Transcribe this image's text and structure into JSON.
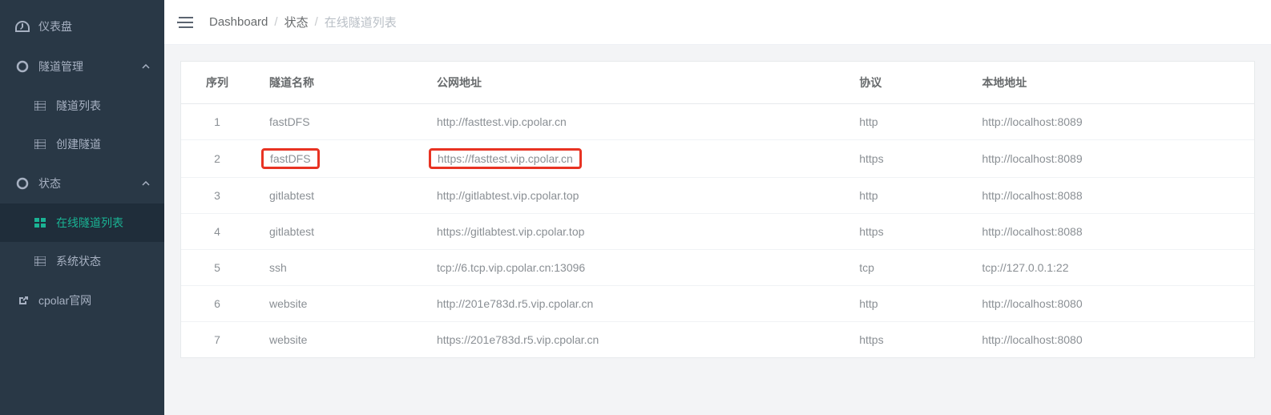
{
  "sidebar": {
    "items": [
      {
        "label": "仪表盘",
        "icon": "dashboard"
      },
      {
        "label": "隧道管理",
        "icon": "ring",
        "expand": true,
        "children": [
          {
            "label": "隧道列表",
            "icon": "table"
          },
          {
            "label": "创建隧道",
            "icon": "table"
          }
        ]
      },
      {
        "label": "状态",
        "icon": "ring",
        "expand": true,
        "children": [
          {
            "label": "在线隧道列表",
            "icon": "grid",
            "active": true
          },
          {
            "label": "系统状态",
            "icon": "table"
          }
        ]
      },
      {
        "label": "cpolar官网",
        "icon": "external"
      }
    ]
  },
  "breadcrumb": {
    "root": "Dashboard",
    "mid": "状态",
    "current": "在线隧道列表"
  },
  "table": {
    "headers": {
      "index": "序列",
      "name": "隧道名称",
      "addr": "公网地址",
      "proto": "协议",
      "local": "本地地址"
    },
    "rows": [
      {
        "index": "1",
        "name": "fastDFS",
        "addr": "http://fasttest.vip.cpolar.cn",
        "proto": "http",
        "local": "http://localhost:8089"
      },
      {
        "index": "2",
        "name": "fastDFS",
        "addr": "https://fasttest.vip.cpolar.cn",
        "proto": "https",
        "local": "http://localhost:8089",
        "hl": true
      },
      {
        "index": "3",
        "name": "gitlabtest",
        "addr": "http://gitlabtest.vip.cpolar.top",
        "proto": "http",
        "local": "http://localhost:8088"
      },
      {
        "index": "4",
        "name": "gitlabtest",
        "addr": "https://gitlabtest.vip.cpolar.top",
        "proto": "https",
        "local": "http://localhost:8088"
      },
      {
        "index": "5",
        "name": "ssh",
        "addr": "tcp://6.tcp.vip.cpolar.cn:13096",
        "proto": "tcp",
        "local": "tcp://127.0.0.1:22"
      },
      {
        "index": "6",
        "name": "website",
        "addr": "http://201e783d.r5.vip.cpolar.cn",
        "proto": "http",
        "local": "http://localhost:8080"
      },
      {
        "index": "7",
        "name": "website",
        "addr": "https://201e783d.r5.vip.cpolar.cn",
        "proto": "https",
        "local": "http://localhost:8080"
      }
    ]
  }
}
